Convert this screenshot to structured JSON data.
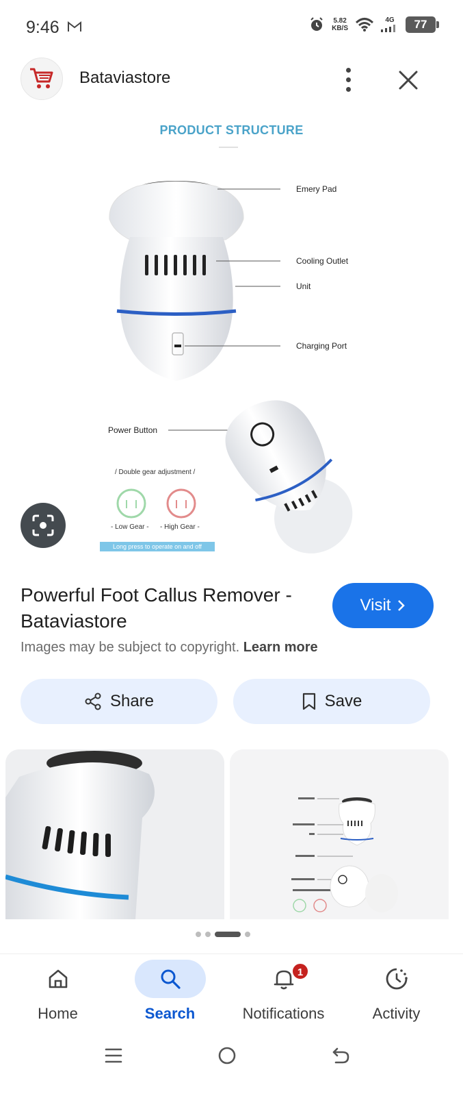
{
  "status_bar": {
    "time": "9:46",
    "net_speed_value": "5.82",
    "net_speed_unit": "KB/S",
    "network": "4G",
    "battery": "77"
  },
  "header": {
    "site_name": "Bataviastore"
  },
  "product_image": {
    "title": "PRODUCT STRUCTURE",
    "callouts": {
      "emery_pad": "Emery Pad",
      "cooling_outlet": "Cooling Outlet",
      "unit": "Unit",
      "charging_port": "Charging Port",
      "power_button": "Power Button"
    },
    "gear_heading": "/ Double gear adjustment /",
    "low_gear": "- Low Gear -",
    "high_gear": "- High Gear -",
    "long_press": "Long press to operate on and off"
  },
  "result": {
    "title": "Powerful Foot Callus Remover - Bataviastore",
    "visit_label": "Visit",
    "copyright_text": "Images may be subject to copyright.",
    "learn_more": "Learn more"
  },
  "actions": {
    "share_label": "Share",
    "save_label": "Save"
  },
  "pagination": {
    "total": 4,
    "active": 2
  },
  "bottom_nav": {
    "items": [
      {
        "label": "Home",
        "icon": "home-icon"
      },
      {
        "label": "Search",
        "icon": "search-icon"
      },
      {
        "label": "Notifications",
        "icon": "bell-icon"
      },
      {
        "label": "Activity",
        "icon": "activity-icon"
      }
    ],
    "active": "Search",
    "notification_count": "1"
  },
  "colors": {
    "accent": "#1a73e8",
    "pill_bg": "#e8f0fe",
    "active_nav": "#0b57d0",
    "badge": "#c5221f",
    "title_teal": "#4aa3c9"
  }
}
